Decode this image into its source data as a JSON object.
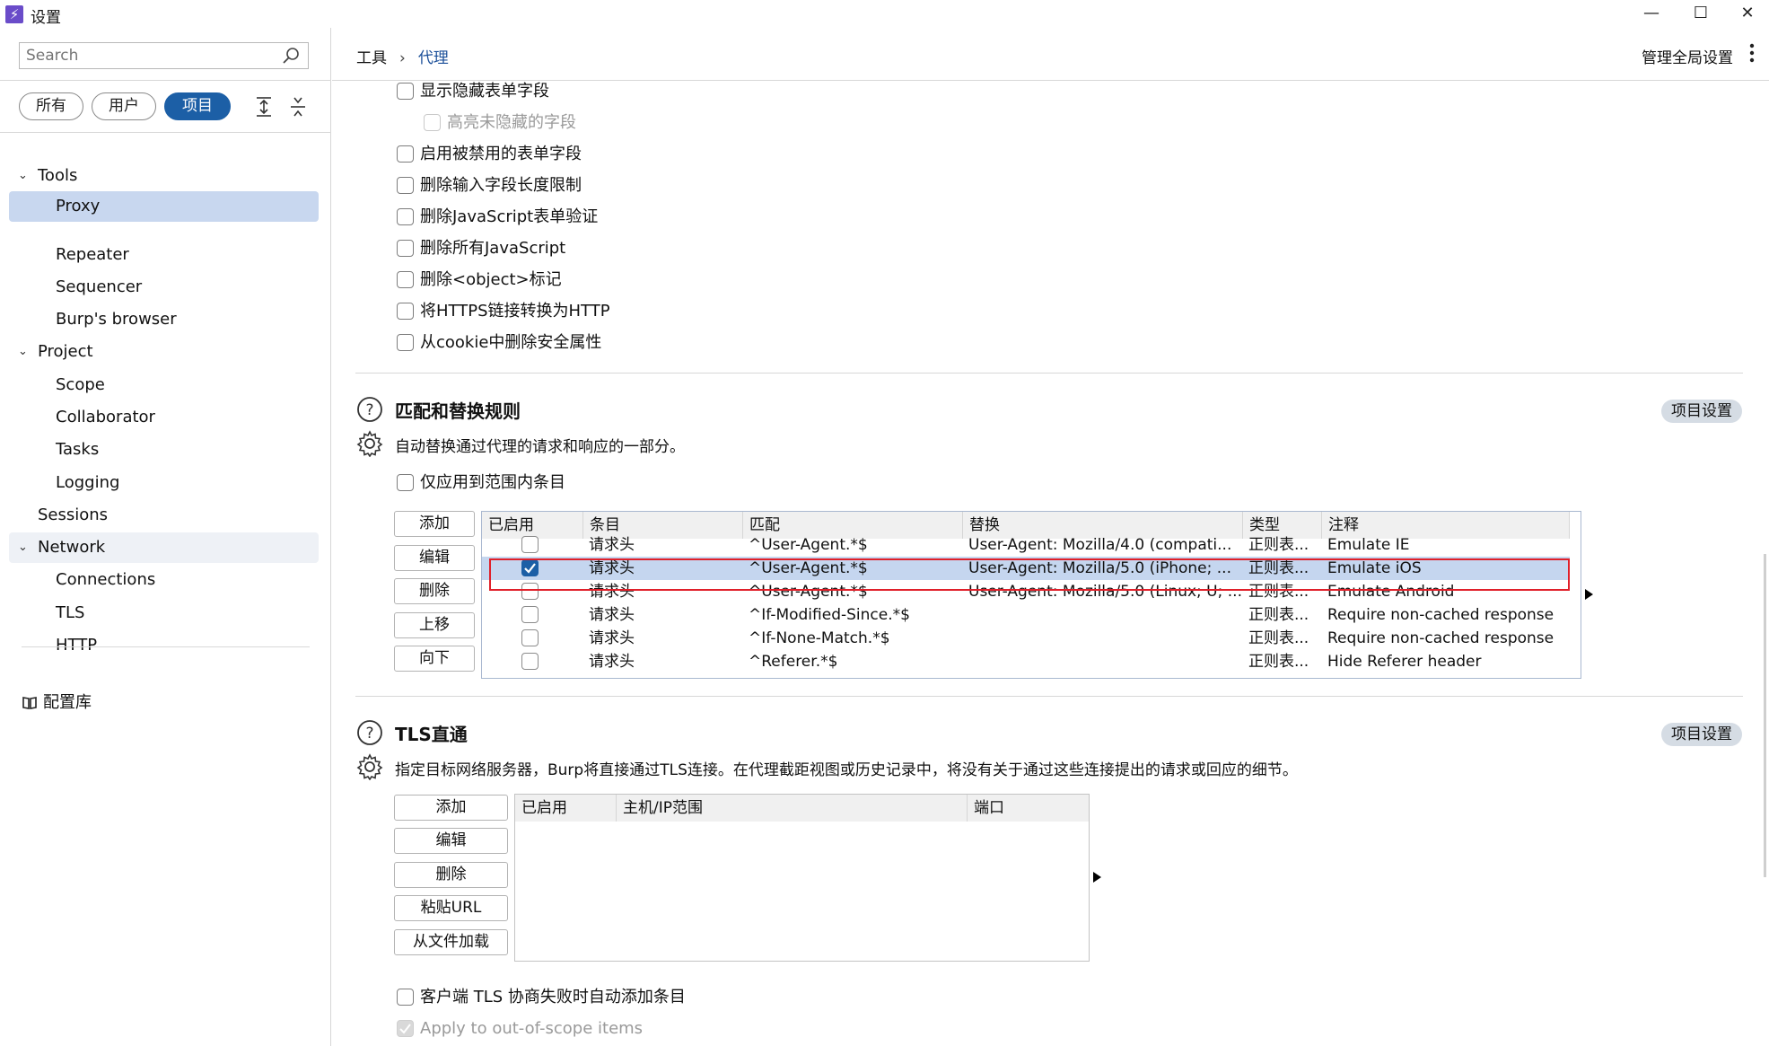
{
  "window": {
    "title": "设置",
    "logo": "⚡"
  },
  "sidebar": {
    "search_placeholder": "Search",
    "filters": [
      {
        "label": "所有",
        "active": false
      },
      {
        "label": "用户",
        "active": false
      },
      {
        "label": "项目",
        "active": true
      }
    ],
    "tree": [
      {
        "label": "Tools",
        "group": true
      },
      {
        "label": "Proxy",
        "selected": true
      },
      {
        "label": "Repeater"
      },
      {
        "label": "Sequencer"
      },
      {
        "label": "Burp's browser"
      },
      {
        "label": "Project",
        "group": true
      },
      {
        "label": "Scope"
      },
      {
        "label": "Collaborator"
      },
      {
        "label": "Tasks"
      },
      {
        "label": "Logging"
      },
      {
        "label": "Sessions",
        "group": true
      },
      {
        "label": "Network",
        "group": true
      },
      {
        "label": "Connections"
      },
      {
        "label": "TLS"
      },
      {
        "label": "HTTP"
      }
    ],
    "library_label": "配置库"
  },
  "header": {
    "breadcrumb": [
      "工具",
      "代理"
    ],
    "manage_label": "管理全局设置"
  },
  "options": [
    {
      "label": "显示隐藏表单字段",
      "checked": false,
      "disabled": false
    },
    {
      "label": "高亮未隐藏的字段",
      "checked": false,
      "disabled": true
    },
    {
      "label": "启用被禁用的表单字段",
      "checked": false,
      "disabled": false
    },
    {
      "label": "删除输入字段长度限制",
      "checked": false,
      "disabled": false
    },
    {
      "label": "删除JavaScript表单验证",
      "checked": false,
      "disabled": false
    },
    {
      "label": "删除所有JavaScript",
      "checked": false,
      "disabled": false
    },
    {
      "label": "删除<object>标记",
      "checked": false,
      "disabled": false
    },
    {
      "label": "将HTTPS链接转换为HTTP",
      "checked": false,
      "disabled": false
    },
    {
      "label": "从cookie中删除安全属性",
      "checked": false,
      "disabled": false
    }
  ],
  "match_replace": {
    "title": "匹配和替换规则",
    "description": "自动替换通过代理的请求和响应的一部分。",
    "project_settings_label": "项目设置",
    "scope_only_label": "仅应用到范围内条目",
    "buttons": [
      "添加",
      "编辑",
      "删除",
      "上移",
      "向下"
    ],
    "columns": [
      "已启用",
      "条目",
      "匹配",
      "替换",
      "类型",
      "注释"
    ],
    "rows": [
      {
        "enabled": false,
        "item": "请求头",
        "match": "^User-Agent.*$",
        "replace": "User-Agent: Mozilla/4.0 (compati...",
        "type": "正则表...",
        "comment": "Emulate IE"
      },
      {
        "enabled": true,
        "item": "请求头",
        "match": "^User-Agent.*$",
        "replace": "User-Agent: Mozilla/5.0 (iPhone; ...",
        "type": "正则表...",
        "comment": "Emulate iOS"
      },
      {
        "enabled": false,
        "item": "请求头",
        "match": "^User-Agent.*$",
        "replace": "User-Agent: Mozilla/5.0 (Linux; U; ...",
        "type": "正则表...",
        "comment": "Emulate Android"
      },
      {
        "enabled": false,
        "item": "请求头",
        "match": "^If-Modified-Since.*$",
        "replace": "",
        "type": "正则表...",
        "comment": "Require non-cached response"
      },
      {
        "enabled": false,
        "item": "请求头",
        "match": "^If-None-Match.*$",
        "replace": "",
        "type": "正则表...",
        "comment": "Require non-cached response"
      },
      {
        "enabled": false,
        "item": "请求头",
        "match": "^Referer.*$",
        "replace": "",
        "type": "正则表...",
        "comment": "Hide Referer header"
      }
    ]
  },
  "tls_passthrough": {
    "title": "TLS直通",
    "description": "指定目标网络服务器，Burp将直接通过TLS连接。在代理截距视图或历史记录中，将没有关于通过这些连接提出的请求或回应的细节。",
    "project_settings_label": "项目设置",
    "buttons": [
      "添加",
      "编辑",
      "删除",
      "粘贴URL",
      "从文件加载"
    ],
    "columns": [
      "已启用",
      "主机/IP范围",
      "端口"
    ],
    "auto_add_label": "客户端 TLS 协商失败时自动添加条目",
    "out_of_scope_label": "Apply to out-of-scope items"
  },
  "colors": {
    "accent": "#1c5fa6",
    "selection": "#c5d6ef",
    "highlight_box": "#e0202a"
  }
}
